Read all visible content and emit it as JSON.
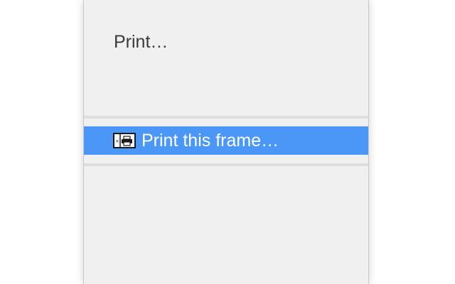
{
  "context_menu": {
    "items": [
      {
        "label": "Print…",
        "highlighted": false
      },
      {
        "label": "Print this frame…",
        "highlighted": true,
        "icon": "print-frame-icon"
      }
    ]
  },
  "colors": {
    "menu_background": "#f0f0f0",
    "highlight": "#4a97f7",
    "separator": "#dedede",
    "text": "#3a3a3a",
    "highlight_text": "#ffffff"
  }
}
